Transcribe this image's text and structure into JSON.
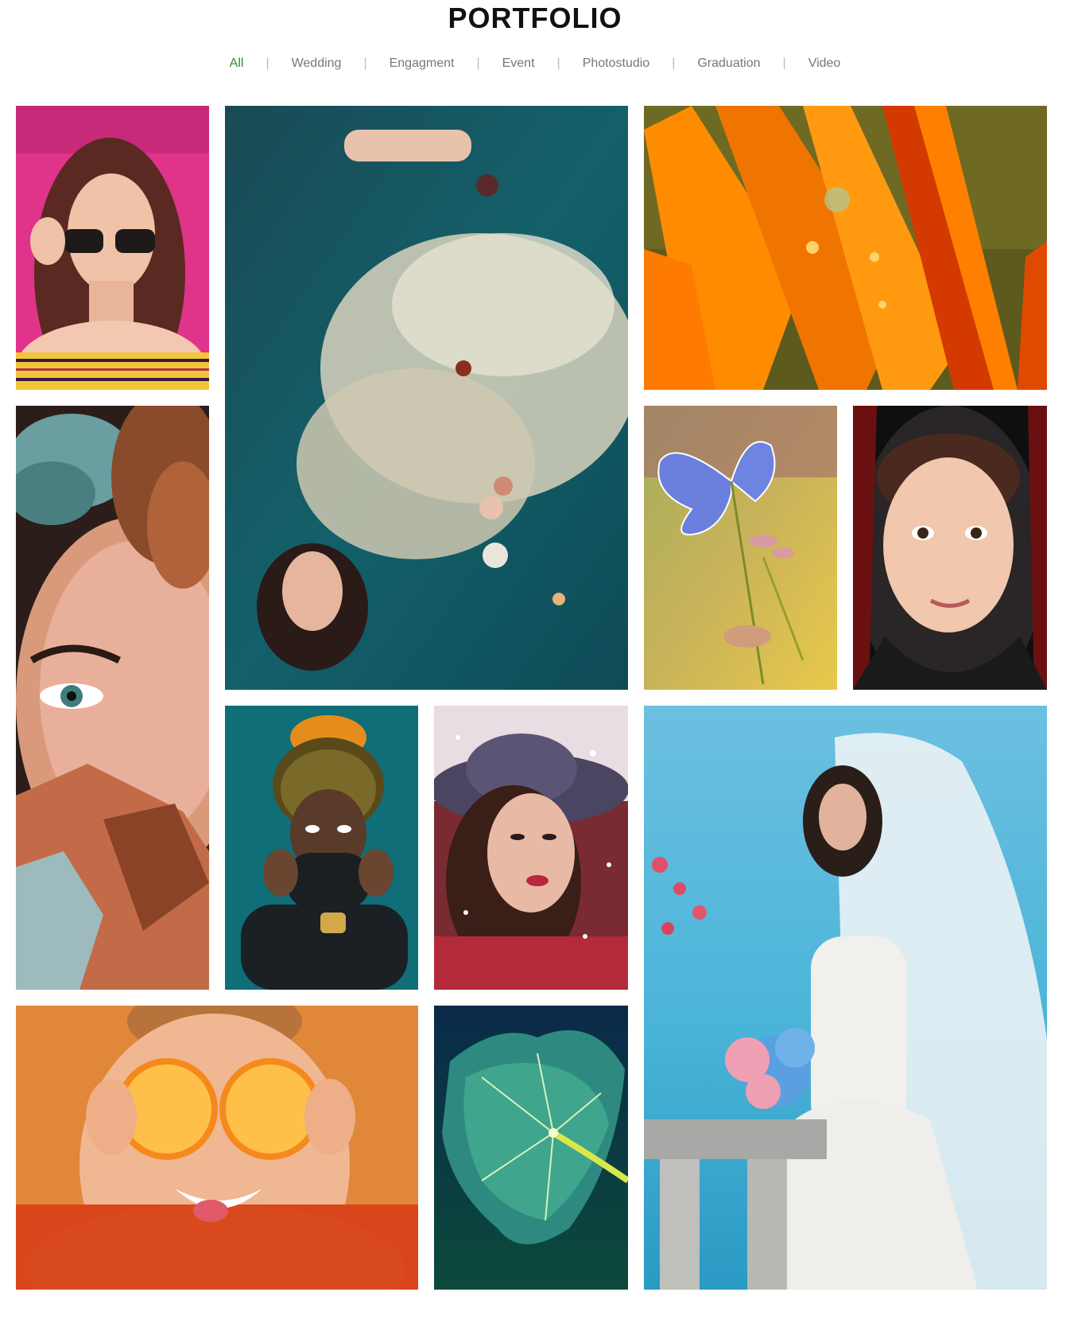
{
  "page": {
    "title": "PORTFOLIO"
  },
  "filters": [
    {
      "label": "All",
      "active": true
    },
    {
      "label": "Wedding",
      "active": false
    },
    {
      "label": "Engagment",
      "active": false
    },
    {
      "label": "Event",
      "active": false
    },
    {
      "label": "Photostudio",
      "active": false
    },
    {
      "label": "Graduation",
      "active": false
    },
    {
      "label": "Video",
      "active": false
    }
  ],
  "accent_color": "#2e8b2e",
  "gallery": [
    {
      "subject": "woman-sunglasses-pink-wall"
    },
    {
      "subject": "woman-in-white-dress-floating-in-water"
    },
    {
      "subject": "orange-flower-petals-with-droplets"
    },
    {
      "subject": "woman-eye-with-roses"
    },
    {
      "subject": "blue-butterfly-on-grass"
    },
    {
      "subject": "little-girl-with-scarf"
    },
    {
      "subject": "woman-braided-hair-teal"
    },
    {
      "subject": "woman-in-hat-snow"
    },
    {
      "subject": "bride-with-bouquet-by-sea"
    },
    {
      "subject": "woman-with-orange-slices"
    },
    {
      "subject": "green-leaf-closeup"
    }
  ]
}
